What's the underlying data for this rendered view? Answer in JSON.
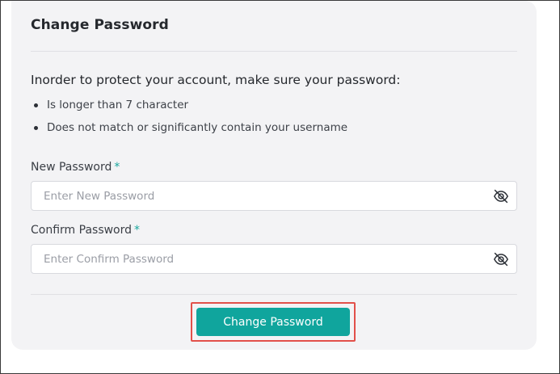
{
  "card": {
    "title": "Change Password",
    "intro": "Inorder to protect your account, make sure your password:",
    "rules": [
      "Is longer than 7 character",
      "Does not match or significantly contain your username"
    ]
  },
  "fields": {
    "new_password": {
      "label": "New Password",
      "required_mark": "*",
      "placeholder": "Enter New Password",
      "value": "",
      "icon": "eye-off-icon"
    },
    "confirm_password": {
      "label": "Confirm Password",
      "required_mark": "*",
      "placeholder": "Enter Confirm Password",
      "value": "",
      "icon": "eye-off-icon"
    }
  },
  "actions": {
    "submit_label": "Change Password"
  },
  "colors": {
    "accent": "#10a59d",
    "required": "#1aa79e",
    "highlight_border": "#e2504a",
    "card_background": "#f3f3f5"
  }
}
